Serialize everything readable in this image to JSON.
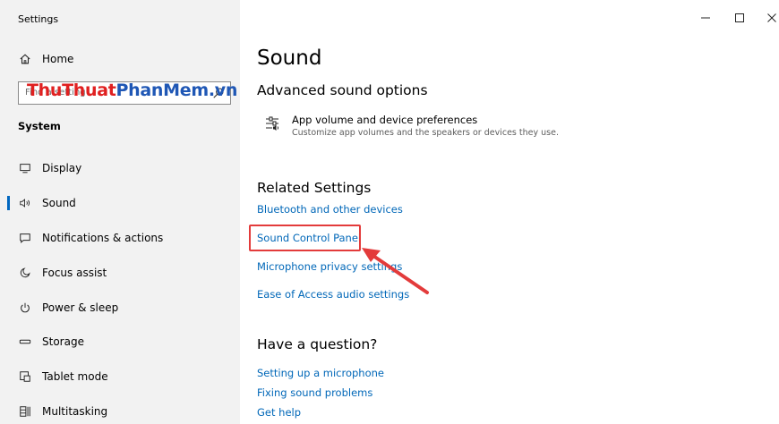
{
  "window": {
    "title": "Settings"
  },
  "sidebar": {
    "home_label": "Home",
    "search_placeholder": "Find a setting",
    "watermark_a": "ThuThuat",
    "watermark_b": "PhanMem.vn",
    "section_label": "System",
    "items": [
      {
        "label": "Display",
        "icon": "display-icon"
      },
      {
        "label": "Sound",
        "icon": "speaker-icon",
        "active": true
      },
      {
        "label": "Notifications & actions",
        "icon": "notification-icon"
      },
      {
        "label": "Focus assist",
        "icon": "moon-icon"
      },
      {
        "label": "Power & sleep",
        "icon": "power-icon"
      },
      {
        "label": "Storage",
        "icon": "storage-icon"
      },
      {
        "label": "Tablet mode",
        "icon": "tablet-mode-icon"
      },
      {
        "label": "Multitasking",
        "icon": "multitasking-icon"
      }
    ]
  },
  "main": {
    "title": "Sound",
    "advanced": {
      "heading": "Advanced sound options",
      "option_title": "App volume and device preferences",
      "option_desc": "Customize app volumes and the speakers or devices they use."
    },
    "related": {
      "heading": "Related Settings",
      "links": [
        "Bluetooth and other devices",
        "Sound Control Panel",
        "Microphone privacy settings",
        "Ease of Access audio settings"
      ]
    },
    "question": {
      "heading": "Have a question?",
      "links": [
        "Setting up a microphone",
        "Fixing sound problems",
        "Get help"
      ]
    }
  },
  "colors": {
    "accent": "#0067c0",
    "link": "#0067b8",
    "highlight": "#e33b3b",
    "sidebar_bg": "#f2f2f2"
  }
}
